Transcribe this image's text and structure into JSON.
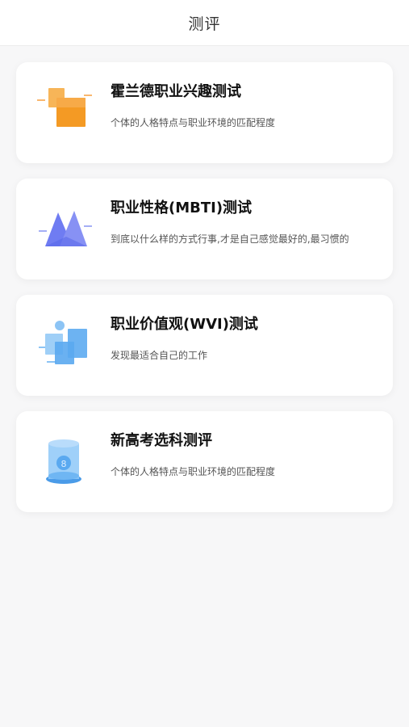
{
  "header": {
    "title": "测评"
  },
  "tests": [
    {
      "title": "霍兰德职业兴趣测试",
      "desc": "个体的人格特点与职业环境的匹配程度",
      "icon": "orange-squares-icon"
    },
    {
      "title": "职业性格(MBTI)测试",
      "desc": "到底以什么样的方式行事,才是自己感觉最好的,最习惯的",
      "icon": "mountain-icon"
    },
    {
      "title": "职业价值观(WVI)测试",
      "desc": "发现最适合自己的工作",
      "icon": "blue-blocks-icon"
    },
    {
      "title": "新高考选科测评",
      "desc": "个体的人格特点与职业环境的匹配程度",
      "icon": "cylinder-icon"
    }
  ],
  "colors": {
    "orange": "#f59a23",
    "purple": "#6f7cf2",
    "blue": "#5aa9f0"
  }
}
